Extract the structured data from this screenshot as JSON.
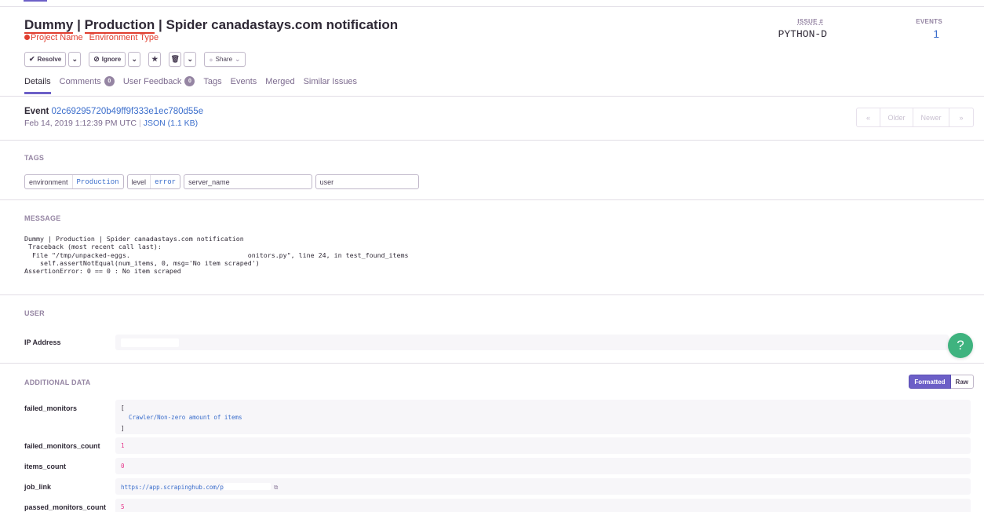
{
  "header": {
    "title_project": "Dummy",
    "title_env": "Production",
    "title_sep": " | ",
    "title_rest": "| Spider canadastays.com notification",
    "annotation_project": "Project Name",
    "annotation_env": "Environment Type",
    "issue_label": "ISSUE #",
    "issue_value": "PYTHON-D",
    "events_label": "EVENTS",
    "events_value": "1"
  },
  "actions": {
    "resolve": "Resolve",
    "ignore": "Ignore",
    "share": "Share"
  },
  "tabs": [
    {
      "label": "Details"
    },
    {
      "label": "Comments",
      "badge": "0"
    },
    {
      "label": "User Feedback",
      "badge": "0"
    },
    {
      "label": "Tags"
    },
    {
      "label": "Events"
    },
    {
      "label": "Merged"
    },
    {
      "label": "Similar Issues"
    }
  ],
  "event": {
    "label": "Event",
    "id": "02c69295720b49ff9f333e1ec780d55e",
    "datetime": "Feb 14, 2019 1:12:39 PM UTC",
    "json_link": "JSON (1.1 KB)"
  },
  "pager": {
    "older": "Older",
    "newer": "Newer"
  },
  "tags_section": {
    "title": "TAGS",
    "tags": [
      {
        "key": "environment",
        "value": "Production"
      },
      {
        "key": "level",
        "value": "error"
      },
      {
        "key": "server_name",
        "value": ""
      },
      {
        "key": "user",
        "value": ""
      }
    ]
  },
  "message_section": {
    "title": "MESSAGE",
    "text": "Dummy | Production | Spider canadastays.com notification\n Traceback (most recent call last):\n  File \"/tmp/unpacked-eggs.                              onitors.py\", line 24, in test_found_items\n    self.assertNotEqual(num_items, 0, msg='No item scraped')\nAssertionError: 0 == 0 : No item scraped"
  },
  "user_section": {
    "title": "USER",
    "ip_label": "IP Address"
  },
  "additional_section": {
    "title": "ADDITIONAL DATA",
    "formatted": "Formatted",
    "raw": "Raw",
    "rows": {
      "failed_monitors_key": "failed_monitors",
      "failed_monitors_open": "[",
      "failed_monitors_item": "Crawler/Non-zero amount of items",
      "failed_monitors_close": "]",
      "failed_monitors_count_key": "failed_monitors_count",
      "failed_monitors_count_val": "1",
      "items_count_key": "items_count",
      "items_count_val": "0",
      "job_link_key": "job_link",
      "job_link_val": "https://app.scrapinghub.com/p",
      "passed_monitors_count_key": "passed_monitors_count",
      "passed_monitors_count_val": "5"
    }
  },
  "help": "?"
}
